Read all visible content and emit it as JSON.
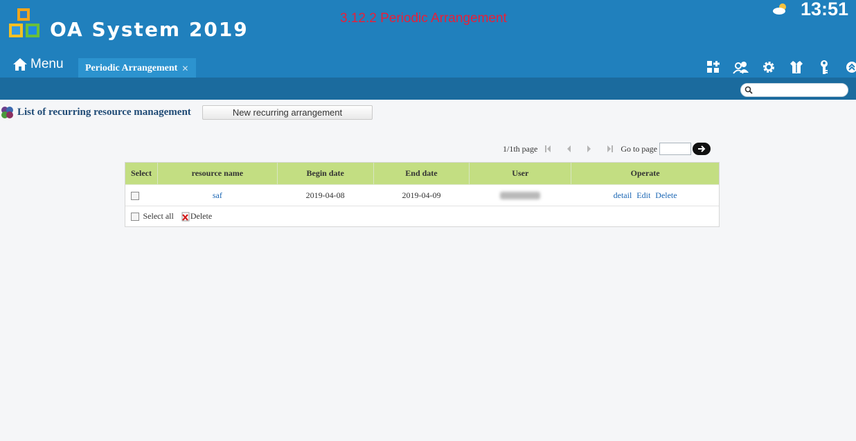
{
  "header": {
    "app_title": "OA System 2019",
    "page_caption": "3.12.2 Periodic Arrangement",
    "clock": "13:51",
    "weather_icon": "partly-cloudy-icon"
  },
  "nav": {
    "menu_label": "Menu",
    "active_tab": "Periodic Arrangement",
    "tab_close": "✕"
  },
  "toolbar": [
    "apps-add-icon",
    "users-icon",
    "gear-icon",
    "shirt-icon",
    "key-icon",
    "collapse-up-icon"
  ],
  "search": {
    "placeholder": ""
  },
  "content": {
    "list_title": "List of recurring resource management",
    "new_button": "New recurring arrangement"
  },
  "pager": {
    "page_info": "1/1th page",
    "goto_label": "Go to page"
  },
  "table": {
    "headers": [
      "Select",
      "resource name",
      "Begin date",
      "End date",
      "User",
      "Operate"
    ],
    "rows": [
      {
        "resource_name": "saf",
        "begin_date": "2019-04-08",
        "end_date": "2019-04-09",
        "user": "",
        "actions": [
          "detail",
          "Edit",
          "Delete"
        ]
      }
    ],
    "footer": {
      "select_all": "Select all",
      "delete": "Delete"
    }
  },
  "colors": {
    "header_bg": "#2080bd",
    "subbar_bg": "#1b6b9e",
    "table_header_bg": "#c3de82",
    "caption_red": "#e6203a",
    "link_blue": "#1a66b4"
  }
}
